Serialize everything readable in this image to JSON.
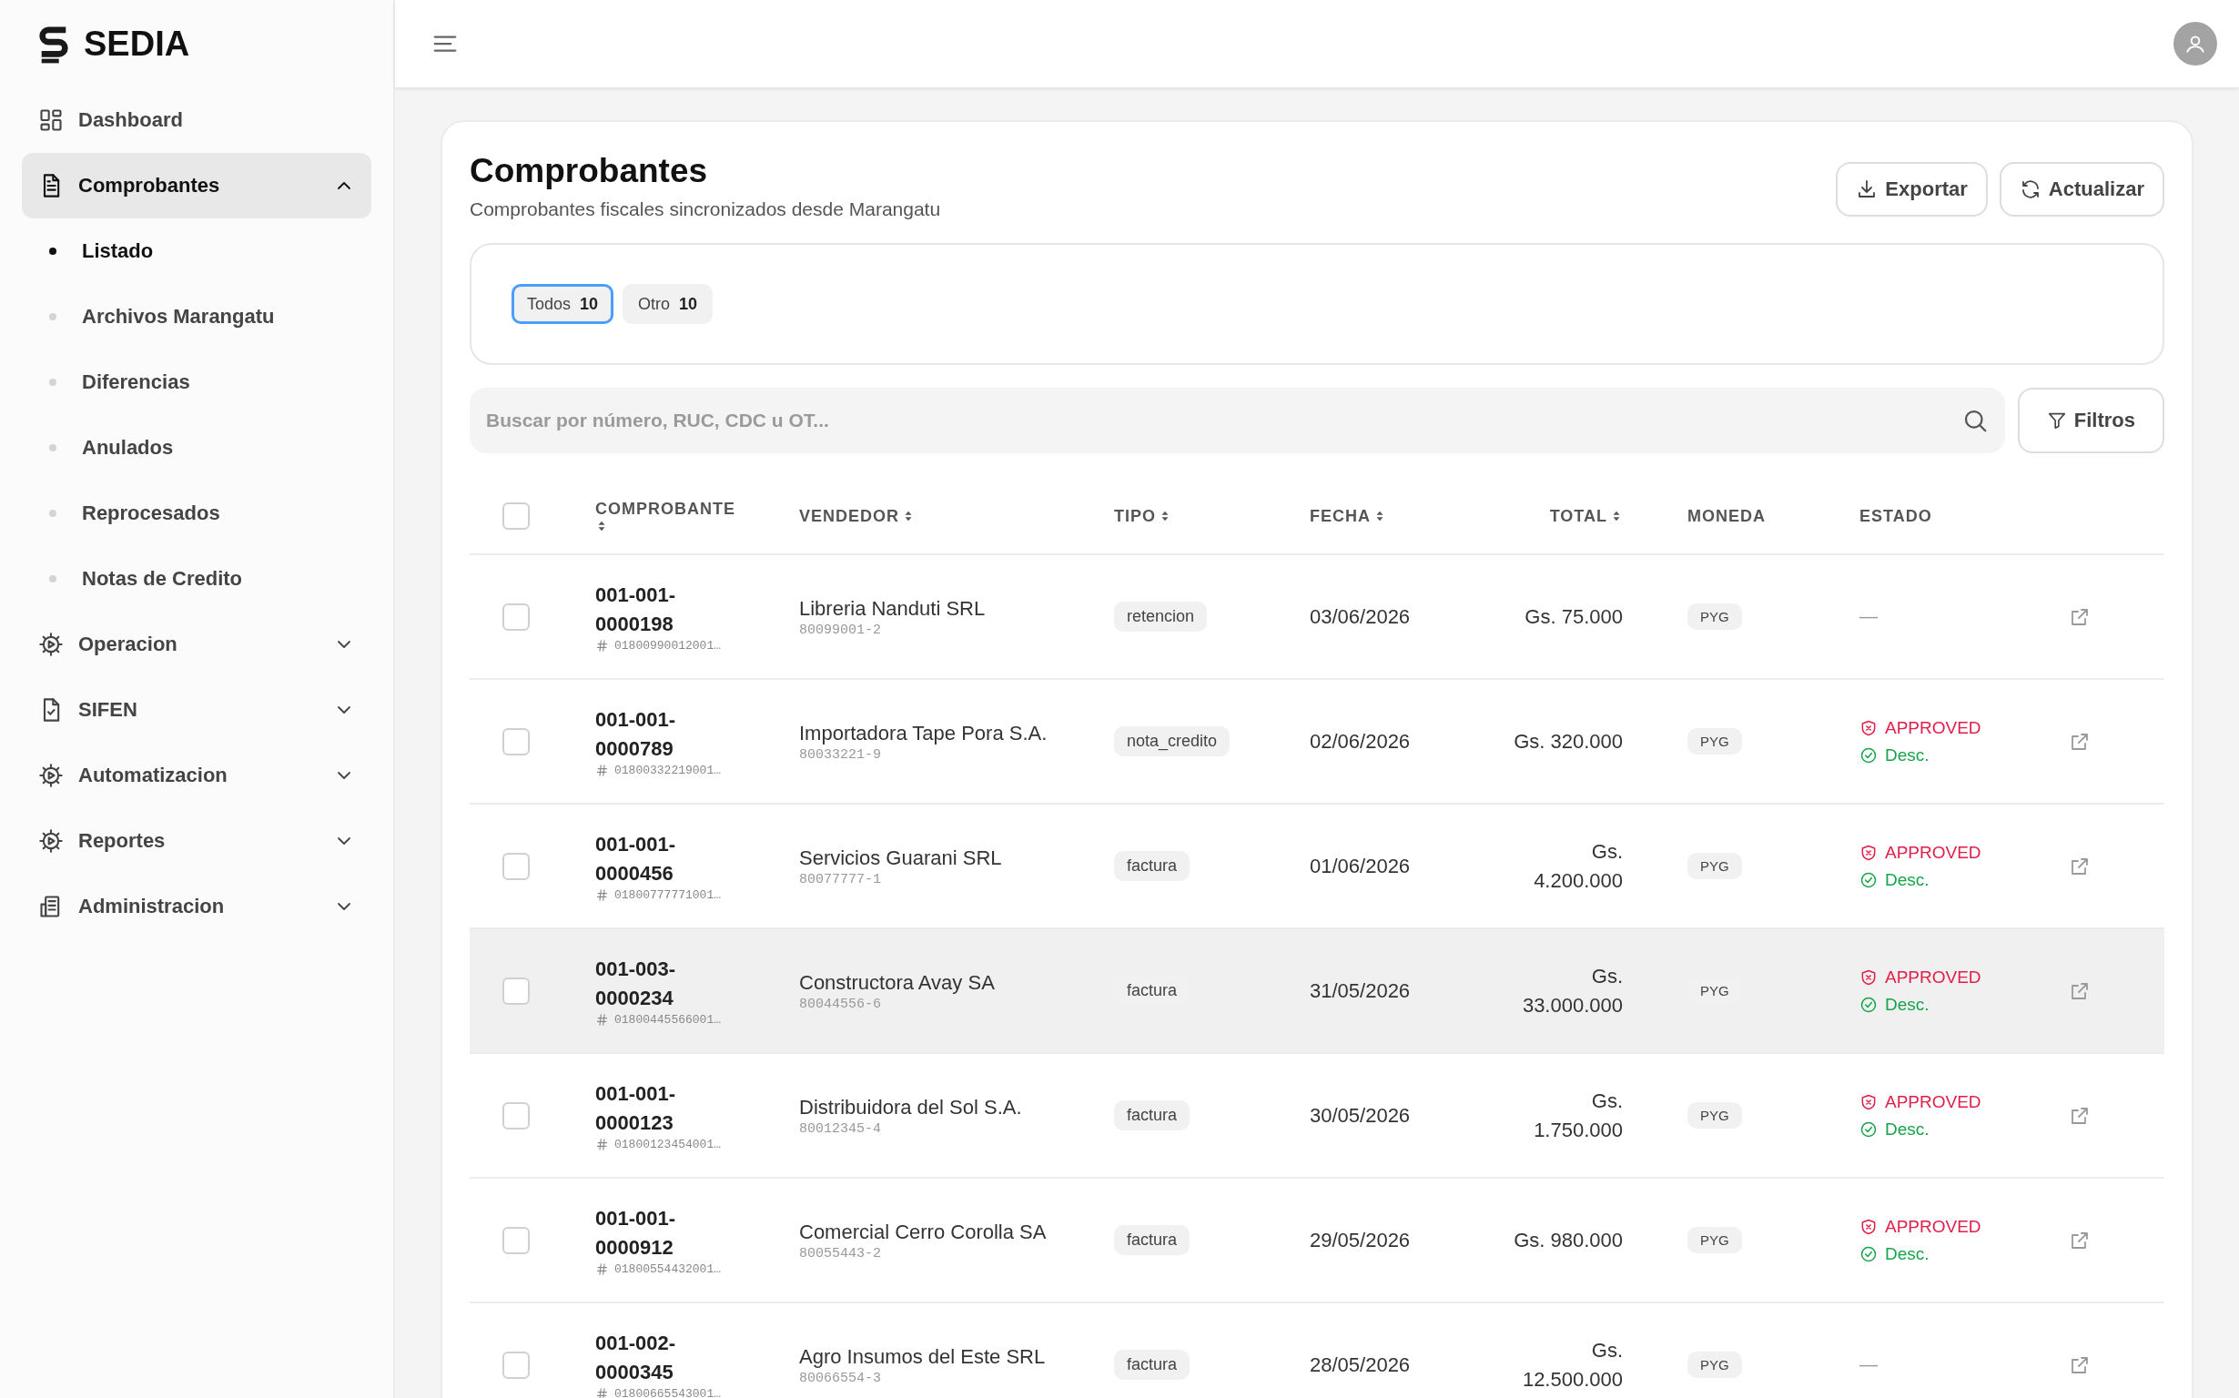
{
  "brand": {
    "name": "SEDIA"
  },
  "sidebar": {
    "items": [
      {
        "kind": "dashboard",
        "label": "Dashboard",
        "selected": false
      },
      {
        "kind": "document",
        "label": "Comprobantes",
        "selected": true,
        "expanded": true,
        "children": [
          {
            "label": "Listado",
            "selected": true
          },
          {
            "label": "Archivos Marangatu",
            "selected": false
          },
          {
            "label": "Diferencias",
            "selected": false
          },
          {
            "label": "Anulados",
            "selected": false
          },
          {
            "label": "Reprocesados",
            "selected": false
          },
          {
            "label": "Notas de Credito",
            "selected": false
          }
        ]
      },
      {
        "kind": "gear",
        "label": "Operacion",
        "selected": false,
        "expanded": false
      },
      {
        "kind": "doc-check",
        "label": "SIFEN",
        "selected": false,
        "expanded": false
      },
      {
        "kind": "gear",
        "label": "Automatizacion",
        "selected": false,
        "expanded": false
      },
      {
        "kind": "gear",
        "label": "Reportes",
        "selected": false,
        "expanded": false
      },
      {
        "kind": "building",
        "label": "Administracion",
        "selected": false,
        "expanded": false
      }
    ]
  },
  "page": {
    "title": "Comprobantes",
    "subtitle": "Comprobantes fiscales sincronizados desde Marangatu",
    "actions": [
      {
        "kind": "download",
        "label": "Exportar"
      },
      {
        "kind": "refresh",
        "label": "Actualizar"
      }
    ]
  },
  "tabs": [
    {
      "label": "Todos",
      "count": "10",
      "selected": true
    },
    {
      "label": "Otro",
      "count": "10",
      "selected": false
    }
  ],
  "search": {
    "placeholder": "Buscar por número, RUC, CDC u OT...",
    "filter_button": "Filtros"
  },
  "table": {
    "select_all_checked": false,
    "columns": [
      {
        "label": "COMPROBANTE",
        "sortable": true
      },
      {
        "label": "VENDEDOR",
        "sortable": true
      },
      {
        "label": "TIPO",
        "sortable": true
      },
      {
        "label": "FECHA",
        "sortable": true
      },
      {
        "label": "TOTAL",
        "sortable": true
      },
      {
        "label": "MONEDA",
        "sortable": false
      },
      {
        "label": "ESTADO",
        "sortable": false
      }
    ],
    "rows": [
      {
        "checked": false,
        "highlighted": false,
        "number": "001-001-0000198",
        "cdc": "01800990012001…",
        "vendor": "Libreria Nanduti SRL",
        "ruc": "80099001-2",
        "type": "retencion",
        "date": "03/06/2026",
        "total": "Gs. 75.000",
        "currency": "PYG",
        "status": [
          {
            "kind": "empty",
            "text": "—"
          }
        ]
      },
      {
        "checked": false,
        "highlighted": false,
        "number": "001-001-0000789",
        "cdc": "01800332219001…",
        "vendor": "Importadora Tape Pora S.A.",
        "ruc": "80033221-9",
        "type": "nota_credito",
        "date": "02/06/2026",
        "total": "Gs. 320.000",
        "currency": "PYG",
        "status": [
          {
            "kind": "alert",
            "text": "APPROVED"
          },
          {
            "kind": "ok",
            "text": "Desc."
          }
        ]
      },
      {
        "checked": false,
        "highlighted": false,
        "number": "001-001-0000456",
        "cdc": "01800777771001…",
        "vendor": "Servicios Guarani SRL",
        "ruc": "80077777-1",
        "type": "factura",
        "date": "01/06/2026",
        "total": "Gs. 4.200.000",
        "currency": "PYG",
        "status": [
          {
            "kind": "alert",
            "text": "APPROVED"
          },
          {
            "kind": "ok",
            "text": "Desc."
          }
        ]
      },
      {
        "checked": false,
        "highlighted": true,
        "number": "001-003-0000234",
        "cdc": "01800445566001…",
        "vendor": "Constructora Avay SA",
        "ruc": "80044556-6",
        "type": "factura",
        "date": "31/05/2026",
        "total": "Gs. 33.000.000",
        "currency": "PYG",
        "status": [
          {
            "kind": "alert",
            "text": "APPROVED"
          },
          {
            "kind": "ok",
            "text": "Desc."
          }
        ]
      },
      {
        "checked": false,
        "highlighted": false,
        "number": "001-001-0000123",
        "cdc": "01800123454001…",
        "vendor": "Distribuidora del Sol S.A.",
        "ruc": "80012345-4",
        "type": "factura",
        "date": "30/05/2026",
        "total": "Gs. 1.750.000",
        "currency": "PYG",
        "status": [
          {
            "kind": "alert",
            "text": "APPROVED"
          },
          {
            "kind": "ok",
            "text": "Desc."
          }
        ]
      },
      {
        "checked": false,
        "highlighted": false,
        "number": "001-001-0000912",
        "cdc": "01800554432001…",
        "vendor": "Comercial Cerro Corolla SA",
        "ruc": "80055443-2",
        "type": "factura",
        "date": "29/05/2026",
        "total": "Gs. 980.000",
        "currency": "PYG",
        "status": [
          {
            "kind": "alert",
            "text": "APPROVED"
          },
          {
            "kind": "ok",
            "text": "Desc."
          }
        ]
      },
      {
        "checked": false,
        "highlighted": false,
        "number": "001-002-0000345",
        "cdc": "01800665543001…",
        "vendor": "Agro Insumos del Este SRL",
        "ruc": "80066554-3",
        "type": "factura",
        "date": "28/05/2026",
        "total": "Gs. 12.500.000",
        "currency": "PYG",
        "status": [
          {
            "kind": "empty",
            "text": "—"
          }
        ]
      }
    ]
  }
}
